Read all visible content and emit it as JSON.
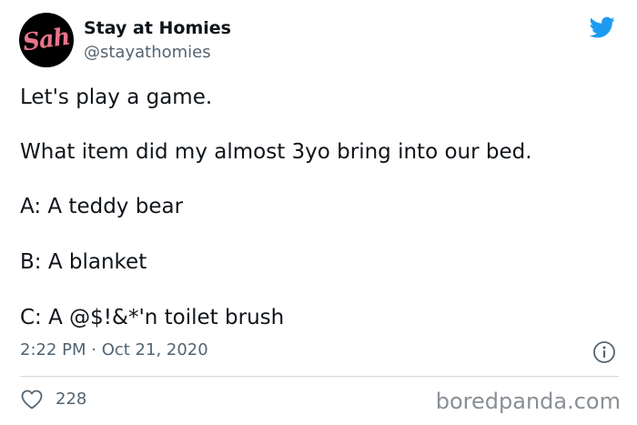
{
  "author": {
    "avatar_text": "Sah",
    "display_name": "Stay at Homies",
    "handle": "@stayathomies"
  },
  "tweet": {
    "lines": [
      "Let's play a game.",
      "What item did my almost 3yo bring into our bed.",
      "A: A teddy bear",
      "B: A blanket",
      "C: A @$!&*'n toilet brush"
    ],
    "timestamp": "2:22 PM · Oct 21, 2020"
  },
  "engagement": {
    "likes": "228"
  },
  "watermark": "boredpanda.com",
  "icons": {
    "brand": "twitter-bird-icon",
    "info": "info-icon",
    "like": "heart-icon"
  },
  "colors": {
    "twitter_blue": "#1d9bf0",
    "secondary_text": "#536471",
    "avatar_accent": "#e8738a"
  }
}
